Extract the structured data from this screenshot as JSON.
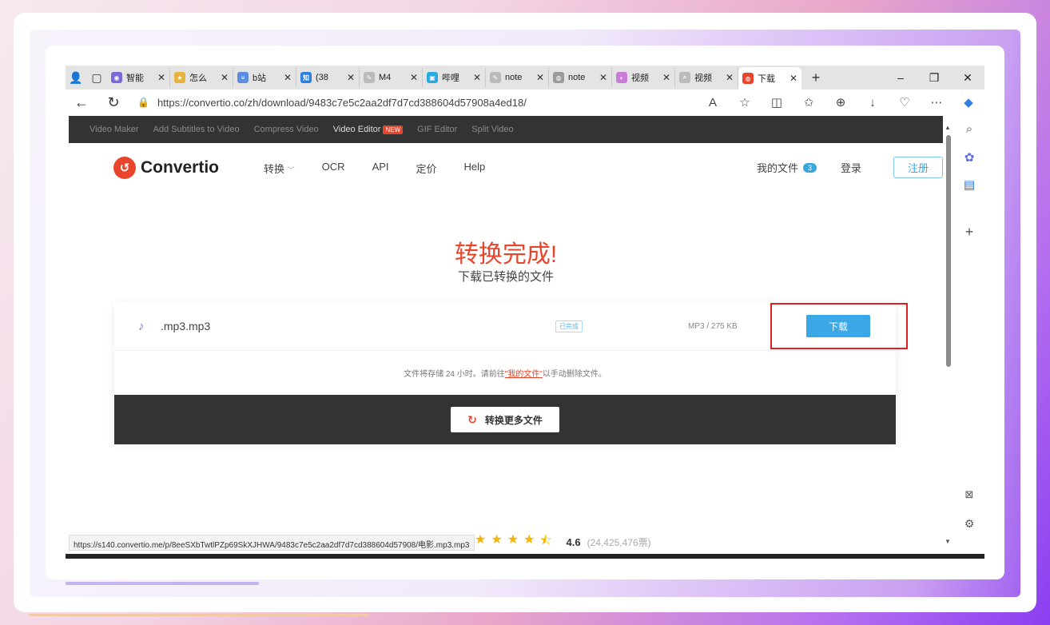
{
  "browser": {
    "tabs": [
      {
        "label": "智能",
        "color": "#7b68d8",
        "glyph": "◉"
      },
      {
        "label": "怎么",
        "color": "#e6b33c",
        "glyph": "★"
      },
      {
        "label": "b站",
        "color": "#5a8de0",
        "glyph": "≡"
      },
      {
        "label": "(38",
        "color": "#2d7fe0",
        "glyph": "知"
      },
      {
        "label": "M4",
        "color": "#bbbbbb",
        "glyph": "✎"
      },
      {
        "label": "哔哩",
        "color": "#2aa8e0",
        "glyph": "▣"
      },
      {
        "label": "note",
        "color": "#bbbbbb",
        "glyph": "✎"
      },
      {
        "label": "note",
        "color": "#9a9a9a",
        "glyph": "◍"
      },
      {
        "label": "视频",
        "color": "#c97bd8",
        "glyph": "◐"
      },
      {
        "label": "视频",
        "color": "#bbbbbb",
        "glyph": "⌕"
      },
      {
        "label": "下载",
        "color": "#e8452c",
        "glyph": "◍",
        "active": true
      }
    ],
    "url": "https://convertio.co/zh/download/9483c7e5c2aa2df7d7cd388604d57908a4ed18/",
    "status_url": "https://s140.convertio.me/p/8eeSXbTwtlPZp69SkXJHWA/9483c7e5c2aa2df7d7cd388604d57908/电影.mp3.mp3"
  },
  "topstrip": {
    "items": [
      "Video Maker",
      "Add Subtitles to Video",
      "Compress Video",
      "Video Editor",
      "GIF Editor",
      "Split Video"
    ],
    "new_badge": "NEW"
  },
  "header": {
    "logo": "Convertio",
    "nav": [
      "转换",
      "OCR",
      "API",
      "定价",
      "Help"
    ],
    "my_files": "我的文件",
    "my_files_count": "3",
    "login": "登录",
    "register": "注册"
  },
  "main": {
    "title": "转换完成!",
    "subtitle": "下载已转换的文件",
    "file": {
      "name": ".mp3.mp3",
      "status": "已完成",
      "meta": "MP3 / 275 KB",
      "download": "下载"
    },
    "storage_note_before": "文件将存储 24 小时。请前往",
    "storage_note_link": "\"我的文件\"",
    "storage_note_after": "以手动删除文件。",
    "more_button": "转换更多文件"
  },
  "rating": {
    "stars": 4.6,
    "score": "4.6",
    "votes": "(24,425,476票)"
  }
}
